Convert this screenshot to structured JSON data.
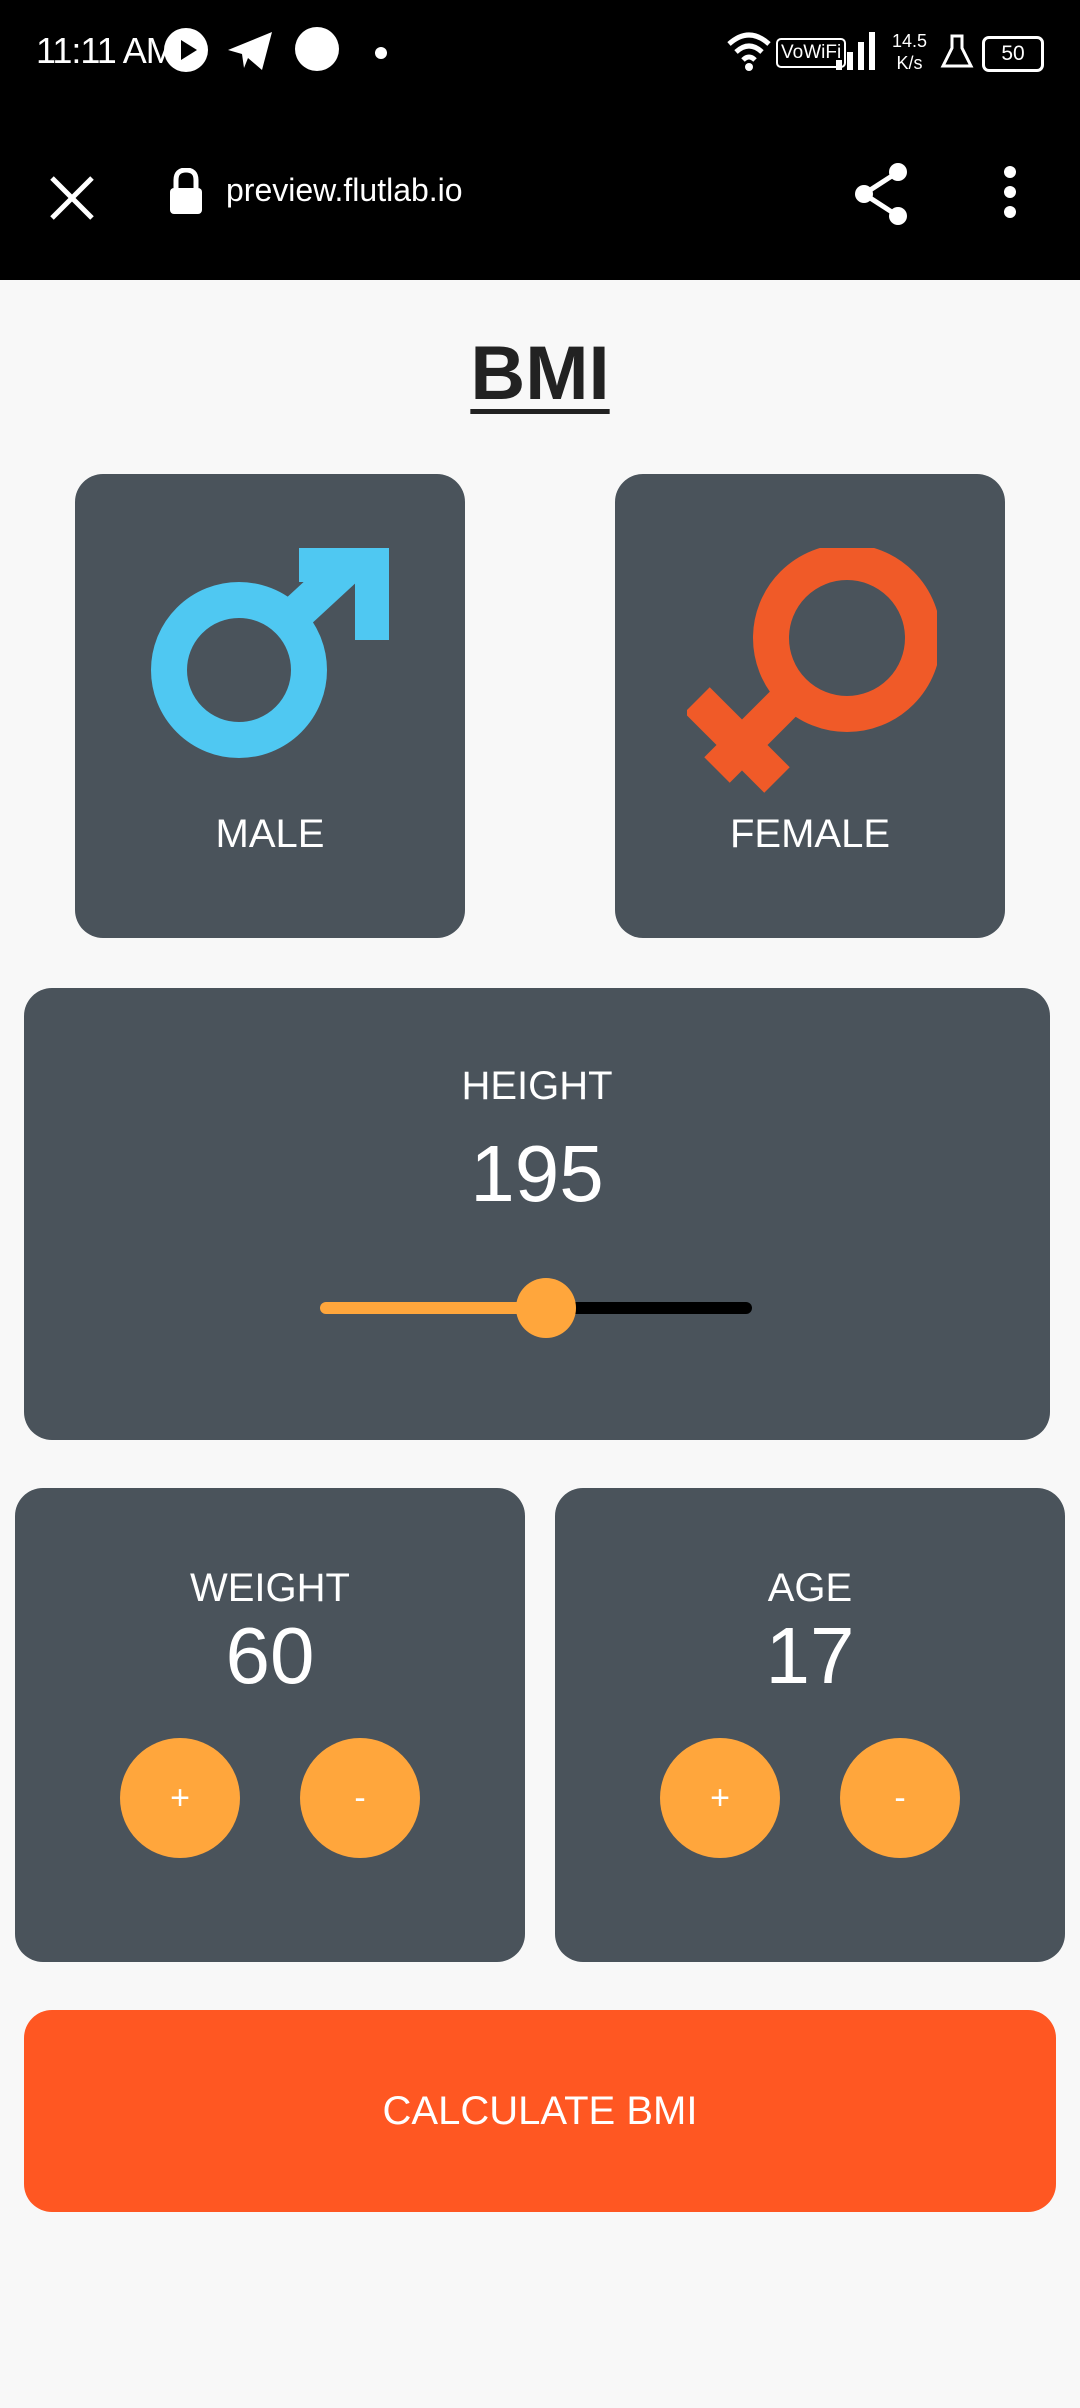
{
  "status_bar": {
    "time": "11:11 AM",
    "network_speed_top": "14.5",
    "network_speed_bottom": "K/s",
    "wifi_label": "VoWiFi",
    "battery": "50"
  },
  "browser": {
    "url": "preview.flutlab.io"
  },
  "app": {
    "title": "BMI",
    "gender": {
      "male_label": "MALE",
      "female_label": "FEMALE",
      "male_color": "#4fc8f2",
      "female_color": "#f05a28"
    },
    "height": {
      "label": "HEIGHT",
      "value": "195",
      "slider_fraction": 0.52
    },
    "weight": {
      "label": "WEIGHT",
      "value": "60",
      "plus_label": "+",
      "minus_label": "-"
    },
    "age": {
      "label": "AGE",
      "value": "17",
      "plus_label": "+",
      "minus_label": "-"
    },
    "calculate_label": "CALCULATE BMI",
    "colors": {
      "card": "#4a535b",
      "accent": "#ffa63c",
      "button": "#ff5722"
    }
  }
}
